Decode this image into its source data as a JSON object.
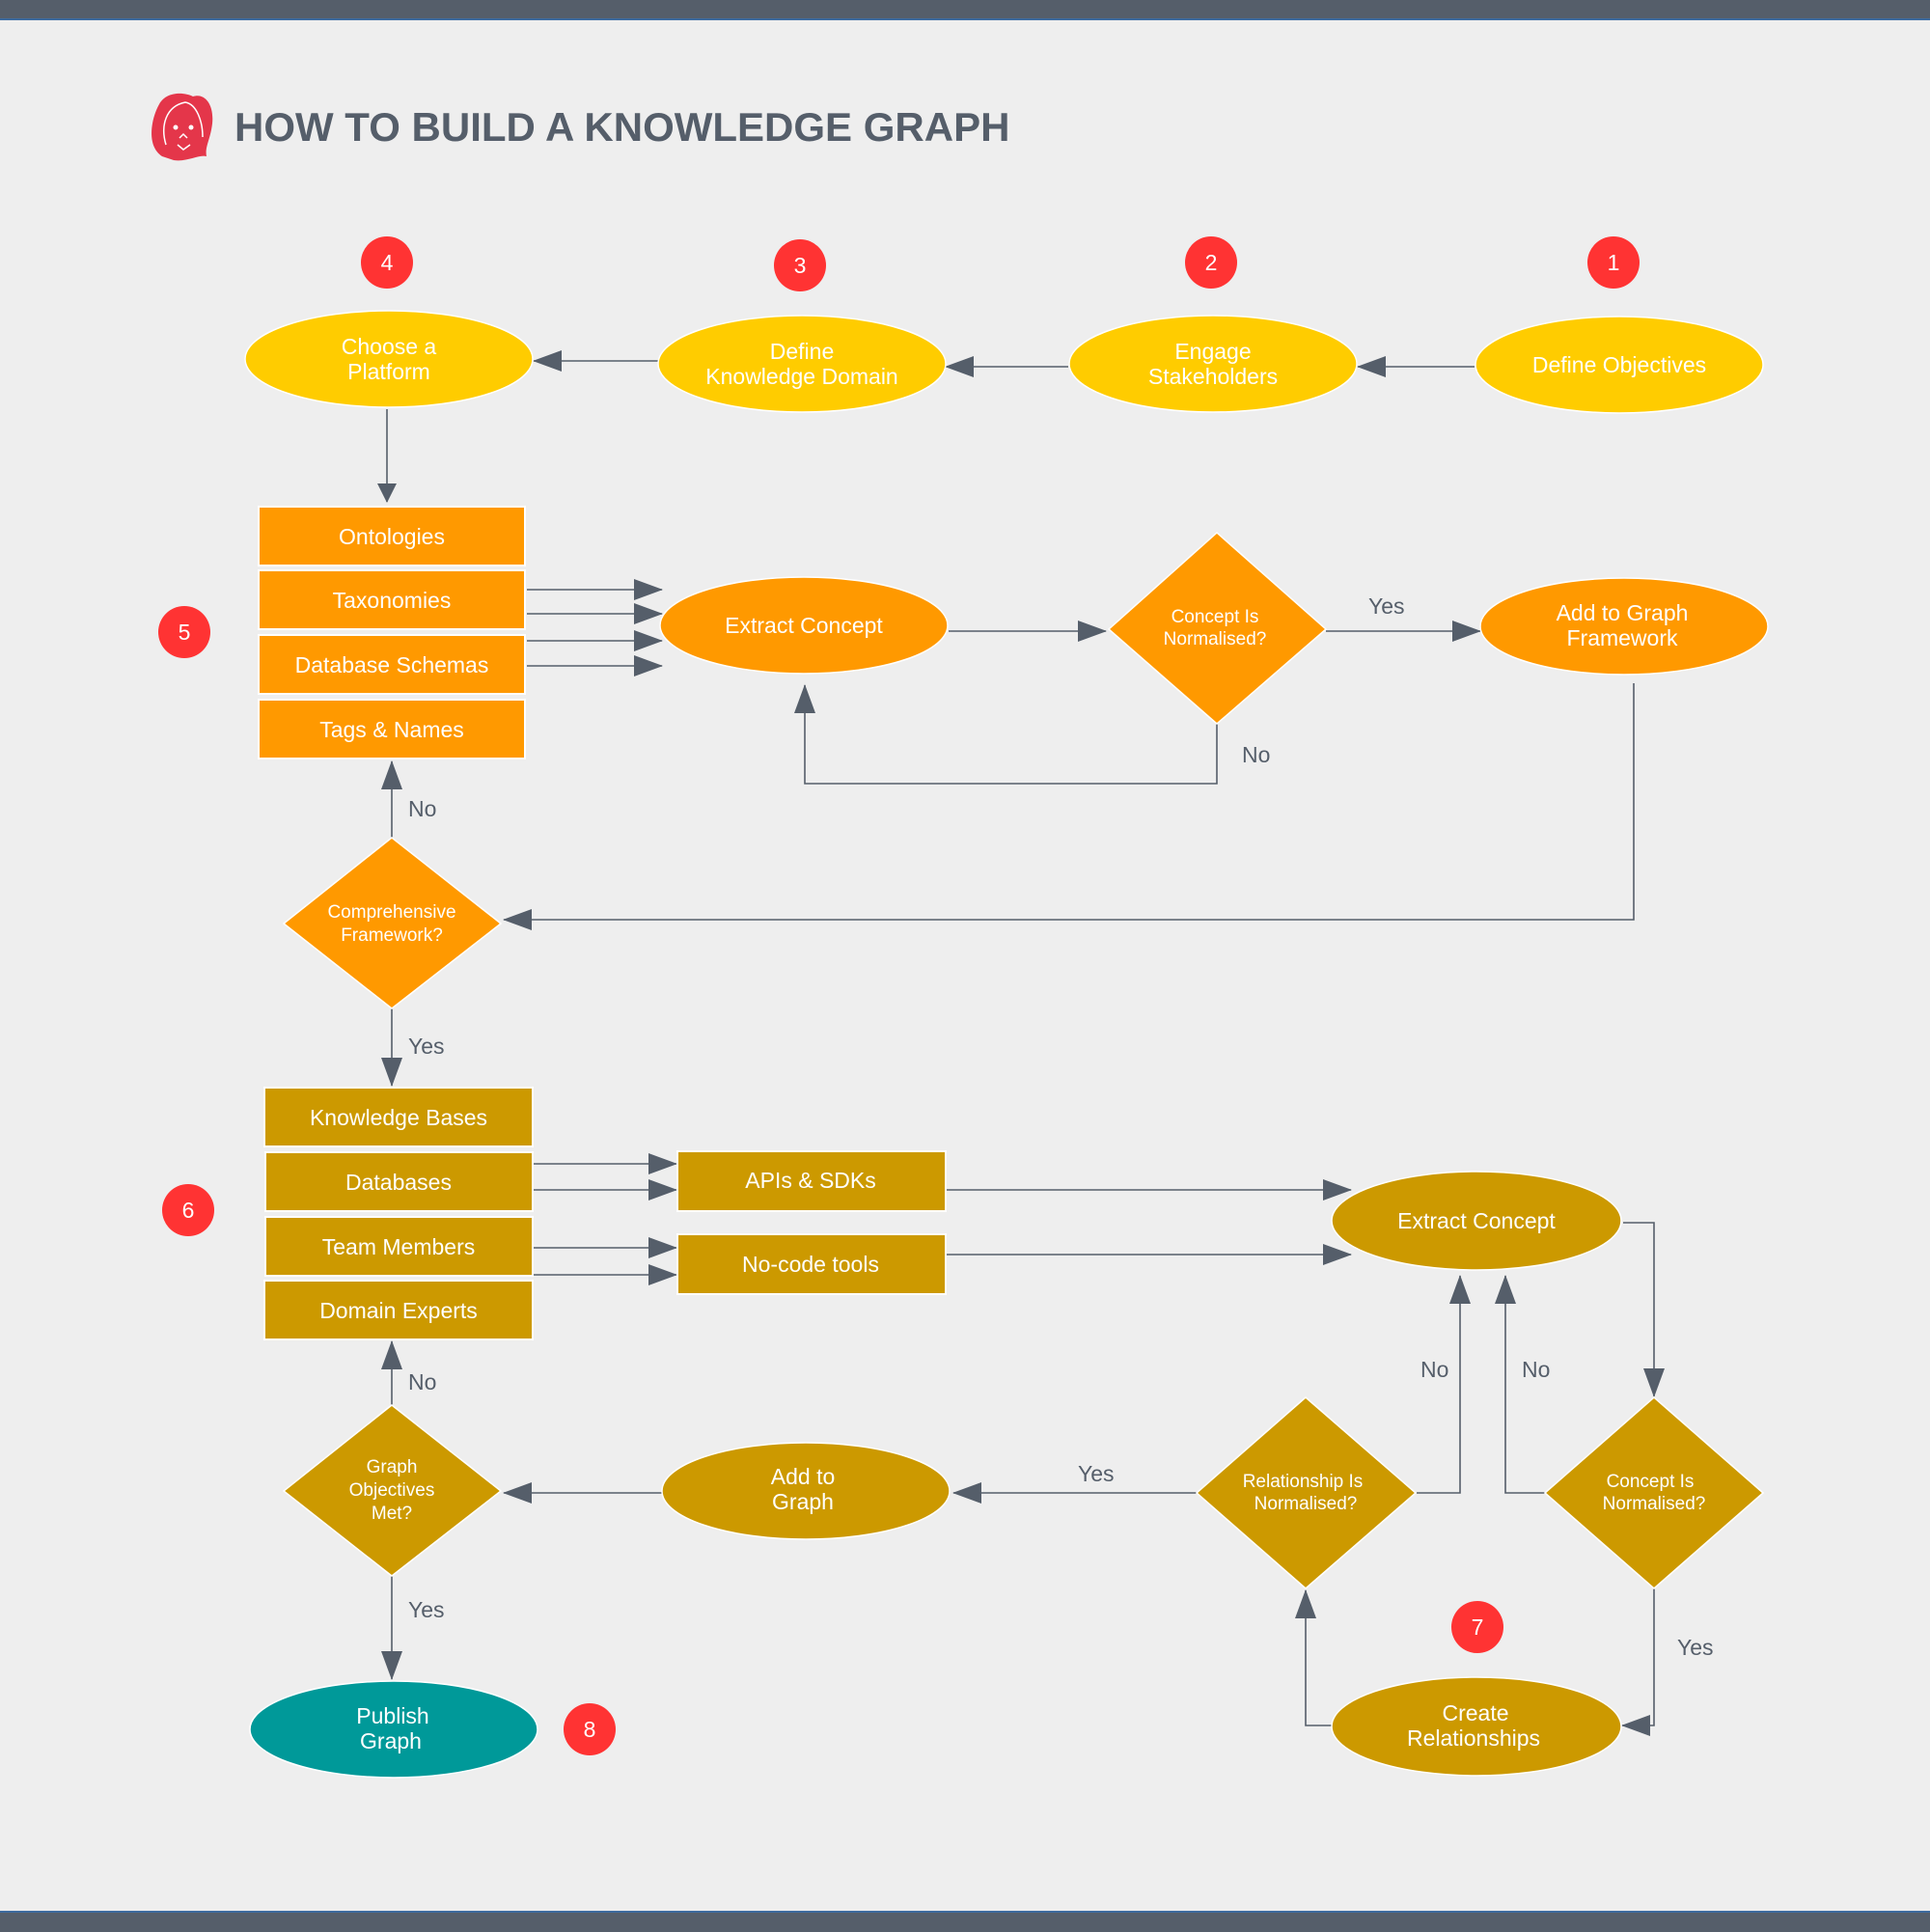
{
  "title": "HOW TO BUILD A KNOWLEDGE GRAPH",
  "logo_icon": "face-avatar-icon",
  "colors": {
    "background": "#eeeeee",
    "frame_bar": "#555e6a",
    "text_dark": "#555e6a",
    "edge": "#555e6a",
    "badge": "#ff3333",
    "logo": "#e4364a",
    "stage_yellow": "#ffcc00",
    "stage_orange": "#ff9900",
    "stage_gold": "#cc9900",
    "stage_teal": "#009999"
  },
  "badges": [
    "1",
    "2",
    "3",
    "4",
    "5",
    "6",
    "7",
    "8"
  ],
  "nodes": {
    "define_objectives": [
      "Define Objectives"
    ],
    "engage_stakeholders": [
      "Engage",
      "Stakeholders"
    ],
    "define_domain": [
      "Define",
      "Knowledge Domain"
    ],
    "choose_platform": [
      "Choose a",
      "Platform"
    ],
    "sources_1": [
      "Ontologies",
      "Taxonomies",
      "Database Schemas",
      "Tags & Names"
    ],
    "extract_concept_1": [
      "Extract Concept"
    ],
    "concept_normalised_1": [
      "Concept Is",
      "Normalised?"
    ],
    "add_to_framework": [
      "Add to Graph",
      "Framework"
    ],
    "comprehensive_framework": [
      "Comprehensive",
      "Framework?"
    ],
    "sources_2": [
      "Knowledge Bases",
      "Databases",
      "Team Members",
      "Domain Experts"
    ],
    "apis_sdks": [
      "APIs & SDKs"
    ],
    "nocode_tools": [
      "No-code tools"
    ],
    "extract_concept_2": [
      "Extract Concept"
    ],
    "concept_normalised_2": [
      "Concept Is",
      "Normalised?"
    ],
    "relationship_normalised": [
      "Relationship Is",
      "Normalised?"
    ],
    "create_relationships": [
      "Create",
      "Relationships"
    ],
    "add_to_graph": [
      "Add to",
      "Graph"
    ],
    "objectives_met": [
      "Graph",
      "Objectives",
      "Met?"
    ],
    "publish_graph": [
      "Publish",
      "Graph"
    ]
  },
  "edge_labels": {
    "yes": "Yes",
    "no": "No"
  }
}
